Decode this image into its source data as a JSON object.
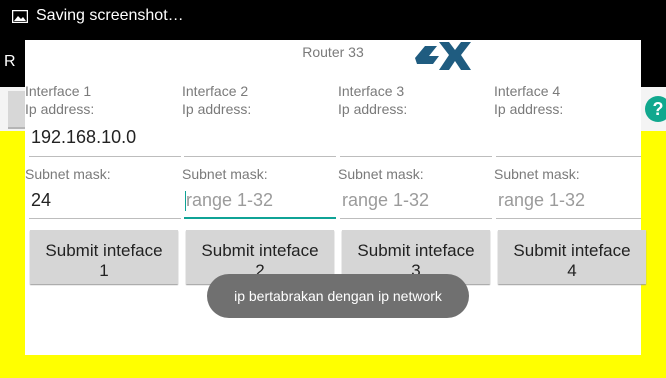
{
  "status": {
    "text": "Saving screenshot…",
    "icon": "image-icon"
  },
  "appbar": {
    "title_fragment": "R"
  },
  "dialog": {
    "title": "Router 33",
    "interfaces": [
      {
        "heading": "Interface 1",
        "ip_label": "Ip address:",
        "ip_value": "192.168.10.0",
        "subnet_label": "Subnet mask:",
        "subnet_value": "24",
        "subnet_placeholder": "range 1-32",
        "submit_label": "Submit inteface\n1"
      },
      {
        "heading": "Interface 2",
        "ip_label": "Ip address:",
        "ip_value": "",
        "subnet_label": "Subnet mask:",
        "subnet_value": "",
        "subnet_placeholder": "range 1-32",
        "submit_label": "Submit inteface\n2"
      },
      {
        "heading": "Interface 3",
        "ip_label": "Ip address:",
        "ip_value": "",
        "subnet_label": "Subnet mask:",
        "subnet_value": "",
        "subnet_placeholder": "range 1-32",
        "submit_label": "Submit inteface\n3"
      },
      {
        "heading": "Interface 4",
        "ip_label": "Ip address:",
        "ip_value": "",
        "subnet_label": "Subnet mask:",
        "subnet_value": "",
        "subnet_placeholder": "range 1-32",
        "submit_label": "Submit inteface\n4"
      }
    ]
  },
  "toast": {
    "text": "ip bertabrakan dengan ip network"
  },
  "help": {
    "label": "?"
  },
  "colors": {
    "background": "#ffff00",
    "accent": "#0fa396",
    "toast": "#707070"
  }
}
